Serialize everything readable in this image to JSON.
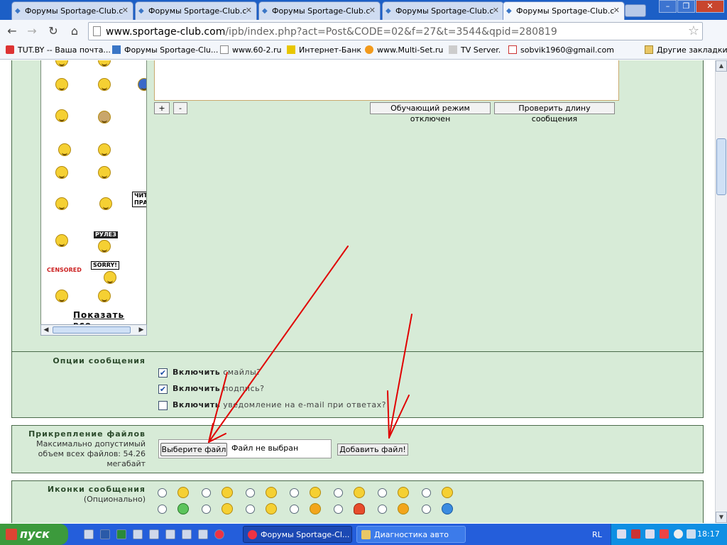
{
  "browser": {
    "tabs": [
      {
        "label": "Форумы Sportage-Club.c"
      },
      {
        "label": "Форумы Sportage-Club.c"
      },
      {
        "label": "Форумы Sportage-Club.c"
      },
      {
        "label": "Форумы Sportage-Club.c"
      },
      {
        "label": "Форумы Sportage-Club.c"
      }
    ],
    "url_host": "www.sportage-club.com",
    "url_path": "/ipb/index.php?act=Post&CODE=02&f=27&t=3544&qpid=280819",
    "bookmarks": [
      {
        "label": "TUT.BY -- Ваша почта..."
      },
      {
        "label": "Форумы Sportage-Clu..."
      },
      {
        "label": "www.60-2.ru"
      },
      {
        "label": "Интернет-Банк"
      },
      {
        "label": "www.Multi-Set.ru"
      },
      {
        "label": "TV Server."
      },
      {
        "label": "sobvik1960@gmail.com"
      },
      {
        "label": "Другие закладки"
      }
    ]
  },
  "page": {
    "editor": {
      "plus": "+",
      "minus": "-",
      "tutorial_button": "Обучающий режим отключен",
      "check_length_button": "Проверить длину сообщения"
    },
    "smileys": {
      "show_all": "Показать все",
      "sign_rules": "ЧИТ ПРАВ",
      "rulez": "РУЛЕЗ",
      "sorry": "SORRY!",
      "censored": "CENSORED"
    },
    "options": {
      "title": "Опции сообщения",
      "items": [
        {
          "bold": "Включить",
          "text": "смайлы?",
          "checked": "true"
        },
        {
          "bold": "Включить",
          "text": "подпись?",
          "checked": "true"
        },
        {
          "bold": "Включить",
          "text": "уведомление на e-mail при ответах?",
          "checked": "false"
        }
      ]
    },
    "attachments": {
      "title": "Прикрепление файлов",
      "desc_line1": "Максимально допустимый",
      "desc_line2": "объем всех файлов: 54.26",
      "desc_line3": "мегабайт",
      "choose_file": "Выберите файл",
      "no_file": "Файл не выбран",
      "add_file": "Добавить файл!"
    },
    "post_icons": {
      "title": "Иконки сообщения",
      "subtitle": "(Опционально)"
    }
  },
  "taskbar": {
    "start": "пуск",
    "tasks": [
      {
        "label": "Форумы Sportage-Cl..."
      },
      {
        "label": "Диагностика авто"
      }
    ],
    "lang": "RL",
    "clock": "18:17"
  },
  "colors": {
    "panel_bg": "#d7ebd7",
    "annotation_arrow": "#e00000",
    "tab_strip": "#1c5fc6",
    "taskbar": "#245edb"
  }
}
